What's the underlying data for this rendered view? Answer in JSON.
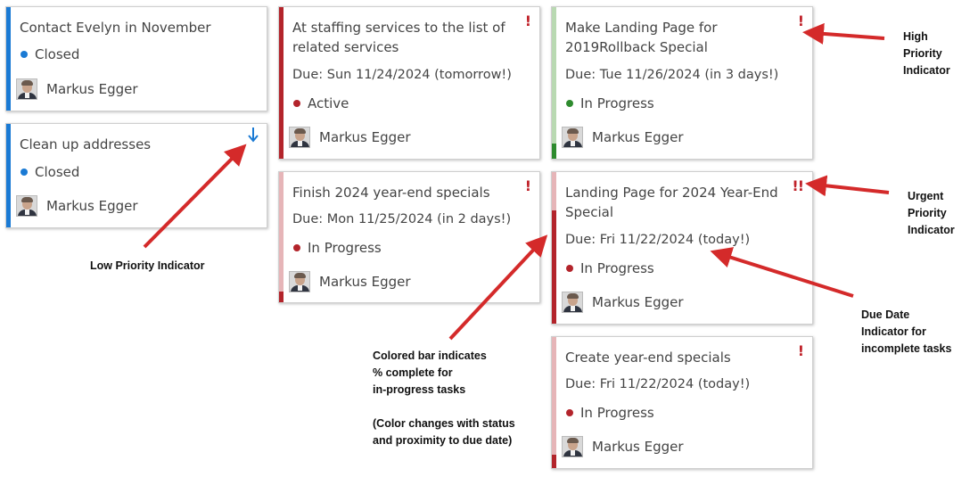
{
  "user_name": "Markus Egger",
  "colors": {
    "closed": "#1a7ad4",
    "active": "#b3242b",
    "in_progress_green": "#2e8b2e",
    "in_progress_red": "#b3242b",
    "bar_light_red": "#e6b5b8",
    "bar_light_green": "#b9d9b2",
    "arrow": "#d42a2a"
  },
  "cards": [
    {
      "title": "Contact Evelyn in November",
      "status": "Closed",
      "priority": "normal"
    },
    {
      "title": "Clean up addresses",
      "status": "Closed",
      "priority": "low",
      "priority_icon": "arrow-down-icon"
    },
    {
      "title_line1": "At staffing services to the list of",
      "title_line2": "related services",
      "due": "Due: Sun 11/24/2024 (tomorrow!)",
      "status": "Active",
      "priority": "high",
      "priority_symbol": "!"
    },
    {
      "title": "Finish 2024 year-end specials",
      "due": "Due: Mon 11/25/2024 (in 2 days!)",
      "status": "In Progress",
      "priority": "high",
      "priority_symbol": "!",
      "percent_complete": 8
    },
    {
      "title_line1": "Make Landing Page for",
      "title_line2": "2019Rollback Special",
      "due": "Due: Tue 11/26/2024 (in 3 days!)",
      "status": "In Progress",
      "priority": "high",
      "priority_symbol": "!",
      "percent_complete": 10
    },
    {
      "title_line1": "Landing Page for 2024 Year-End",
      "title_line2": "Special",
      "due": "Due: Fri 11/22/2024 (today!)",
      "status": "In Progress",
      "priority": "urgent",
      "priority_symbol": "!!",
      "percent_complete": 75
    },
    {
      "title": "Create year-end specials",
      "due": "Due: Fri 11/22/2024 (today!)",
      "status": "In Progress",
      "priority": "high",
      "priority_symbol": "!",
      "percent_complete": 10
    }
  ],
  "annotations": {
    "high_priority": [
      "High",
      "Priority",
      "Indicator"
    ],
    "urgent_priority": [
      "Urgent",
      "Priority",
      "Indicator"
    ],
    "low_priority": "Low Priority Indicator",
    "due_date": [
      "Due Date",
      "Indicator for",
      "incomplete tasks"
    ],
    "colored_bar": [
      "Colored bar indicates",
      "% complete for",
      "in-progress tasks",
      "",
      "(Color changes with status",
      "and proximity to due date)"
    ]
  }
}
